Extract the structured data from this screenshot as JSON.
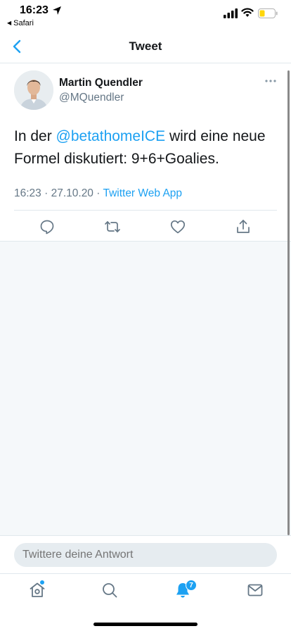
{
  "status_bar": {
    "time": "16:23",
    "back_app_label": "Safari",
    "icons": [
      "location-arrow-icon",
      "signal-icon",
      "wifi-icon",
      "battery-icon"
    ],
    "battery_level": 0.35,
    "battery_color": "#ffd60a"
  },
  "nav": {
    "title": "Tweet",
    "back_icon": "chevron-left-icon"
  },
  "tweet": {
    "author_name": "Martin Quendler",
    "author_handle": "@MQuendler",
    "text_before": "In der ",
    "mention": "@betathomeICE",
    "text_after": " wird eine neue Formel diskutiert: 9+6+Goalies.",
    "time": "16:23",
    "date": "27.10.20",
    "separator": "·",
    "source": "Twitter Web App",
    "actions": [
      "reply-icon",
      "retweet-icon",
      "like-icon",
      "share-icon"
    ]
  },
  "reply": {
    "placeholder": "Twittere deine Antwort"
  },
  "tab_bar": {
    "tabs": [
      "home-icon",
      "search-icon",
      "notifications-icon",
      "messages-icon"
    ],
    "notification_count": "7"
  },
  "colors": {
    "accent": "#1da1f2",
    "text_primary": "#14171a",
    "text_secondary": "#657786",
    "background_grey": "#f5f8fa"
  }
}
